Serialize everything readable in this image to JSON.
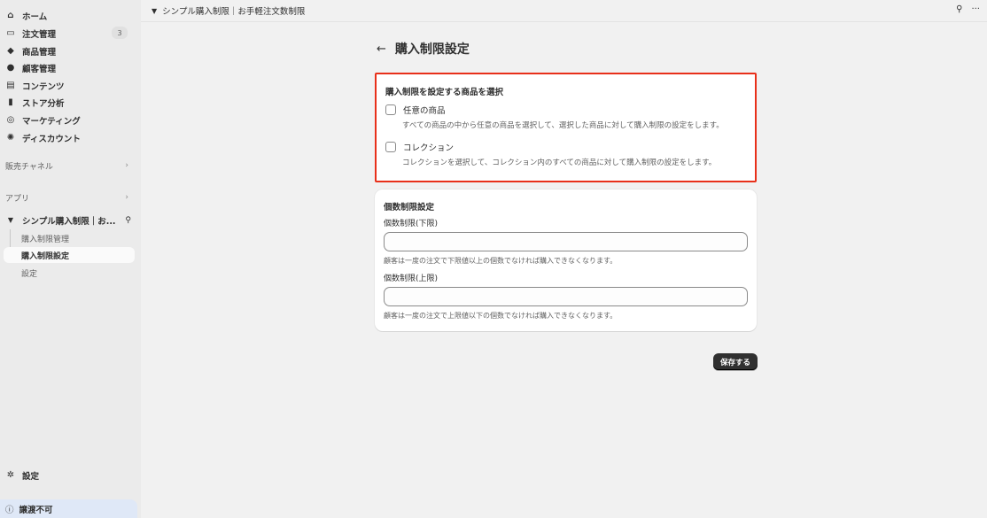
{
  "sidebar": {
    "items": [
      {
        "label": "ホーム",
        "icon": "home-icon",
        "glyph": "⌂"
      },
      {
        "label": "注文管理",
        "icon": "inbox-icon",
        "glyph": "▭",
        "badge": "3"
      },
      {
        "label": "商品管理",
        "icon": "tag-icon",
        "glyph": "◆"
      },
      {
        "label": "顧客管理",
        "icon": "person-icon",
        "glyph": "●"
      },
      {
        "label": "コンテンツ",
        "icon": "content-icon",
        "glyph": "▤"
      },
      {
        "label": "ストア分析",
        "icon": "bar-chart-icon",
        "glyph": "▮"
      },
      {
        "label": "マーケティング",
        "icon": "target-icon",
        "glyph": "◎"
      },
      {
        "label": "ディスカウント",
        "icon": "discount-icon",
        "glyph": "✺"
      }
    ],
    "sales_channels_label": "販売チャネル",
    "apps_label": "アプリ",
    "app": {
      "label": "シンプル購入制限｜お...",
      "icon_glyph": "🛒"
    },
    "app_sub_items": [
      "購入制限管理",
      "購入制限設定",
      "設定"
    ],
    "settings_label": "設定",
    "banner_label": "譲渡不可"
  },
  "topbar": {
    "title": "シンプル購入制限｜お手軽注文数制限"
  },
  "page": {
    "title": "購入制限設定"
  },
  "product_select_card": {
    "title": "購入制限を設定する商品を選択",
    "options": [
      {
        "label": "任意の商品",
        "help": "すべての商品の中から任意の商品を選択して、選択した商品に対して購入制限の設定をします。",
        "checked": false
      },
      {
        "label": "コレクション",
        "help": "コレクションを選択して、コレクション内のすべての商品に対して購入制限の設定をします。",
        "checked": false
      }
    ]
  },
  "quantity_card": {
    "title": "個数制限設定",
    "min_label": "個数制限(下限)",
    "min_value": "",
    "min_help": "顧客は一度の注文で下限値以上の個数でなければ購入できなくなります。",
    "max_label": "個数制限(上限)",
    "max_value": "",
    "max_help": "顧客は一度の注文で上限値以下の個数でなければ購入できなくなります。"
  },
  "save_label": "保存する",
  "colors": {
    "highlight": "#e8301a",
    "primary_button": "#303030"
  }
}
